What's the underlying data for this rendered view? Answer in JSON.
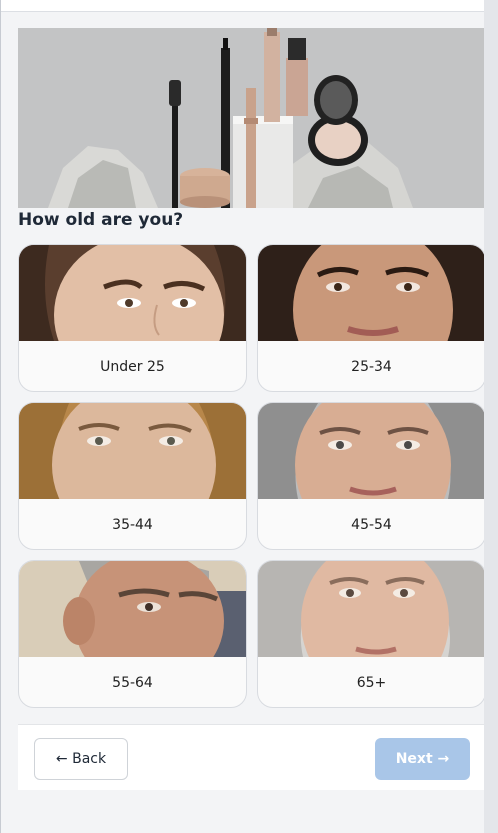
{
  "question": "How old are you?",
  "age_options": [
    {
      "label": "Under 25"
    },
    {
      "label": "25-34"
    },
    {
      "label": "35-44"
    },
    {
      "label": "45-54"
    },
    {
      "label": "55-64"
    },
    {
      "label": "65+"
    }
  ],
  "nav": {
    "back_label": "← Back",
    "next_label": "Next →",
    "next_disabled": true
  },
  "colors": {
    "next_button_disabled": "#a9c6e8",
    "card_background": "#fafafa",
    "page_background": "#f3f4f6"
  }
}
